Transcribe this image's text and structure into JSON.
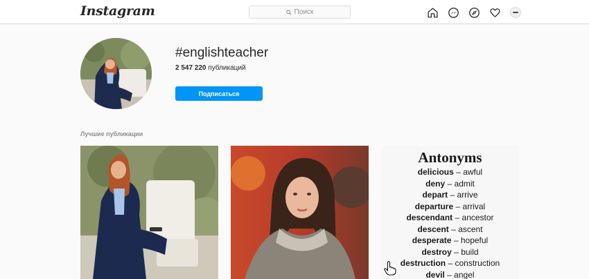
{
  "header": {
    "logo": "Instagram",
    "search_placeholder": "Поиск",
    "nav_icons": [
      "home-icon",
      "messenger-icon",
      "explore-icon",
      "heart-icon",
      "profile-avatar"
    ]
  },
  "profile": {
    "hashtag": "#englishteacher",
    "post_count": "2 547 220",
    "post_count_label": "публикаций",
    "follow_button": "Подписаться"
  },
  "section": {
    "title": "Лучшие публикации"
  },
  "posts": {
    "antonyms_title": "Antonyms",
    "antonyms": [
      {
        "word": "delicious",
        "opposite": "awful"
      },
      {
        "word": "deny",
        "opposite": "admit"
      },
      {
        "word": "depart",
        "opposite": "arrive"
      },
      {
        "word": "departure",
        "opposite": "arrival"
      },
      {
        "word": "descendant",
        "opposite": "ancestor"
      },
      {
        "word": "descent",
        "opposite": "ascent"
      },
      {
        "word": "desperate",
        "opposite": "hopeful"
      },
      {
        "word": "destroy",
        "opposite": "build"
      },
      {
        "word": "destruction",
        "opposite": "construction"
      },
      {
        "word": "devil",
        "opposite": "angel"
      }
    ],
    "dash": "–"
  },
  "colors": {
    "accent": "#0095f6",
    "background": "#fafafa",
    "border": "#dbdbdb"
  }
}
